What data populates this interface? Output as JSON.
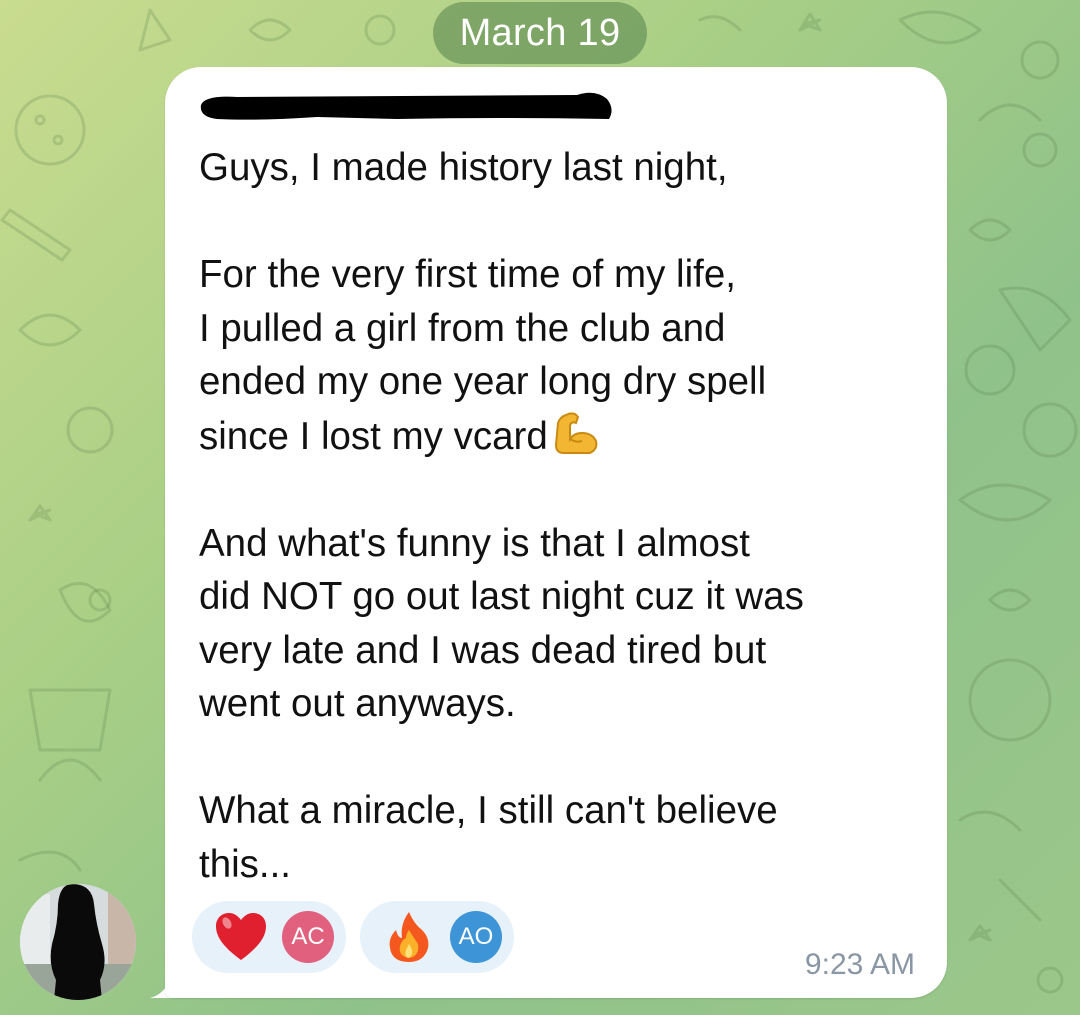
{
  "chat": {
    "date_separator": "March 19",
    "message": {
      "sender_name_redacted": true,
      "text": "Guys, I made history last night,\n\nFor the very first time of my life,\nI pulled a girl from the club and\nended my one year long dry spell\nsince I lost my vcard",
      "text_after_emoji": "\n\nAnd what's funny is that I almost\ndid NOT go out last night cuz it was\nvery late and I was dead tired but\nwent out anyways.\n\nWhat a miracle, I still can't believe\nthis...",
      "inline_emoji": "flexed-biceps-icon",
      "time": "9:23 AM",
      "reactions": [
        {
          "emoji": "heart-icon",
          "user_initials": "AC",
          "badge_color": "#e0607e"
        },
        {
          "emoji": "fire-icon",
          "user_initials": "AO",
          "badge_color": "#3d95d8"
        }
      ]
    }
  },
  "colors": {
    "bubble": "#ffffff",
    "reaction_bg": "#e6f1fa",
    "timestamp": "#8a96a3",
    "date_pill": "#6e9a5e"
  }
}
